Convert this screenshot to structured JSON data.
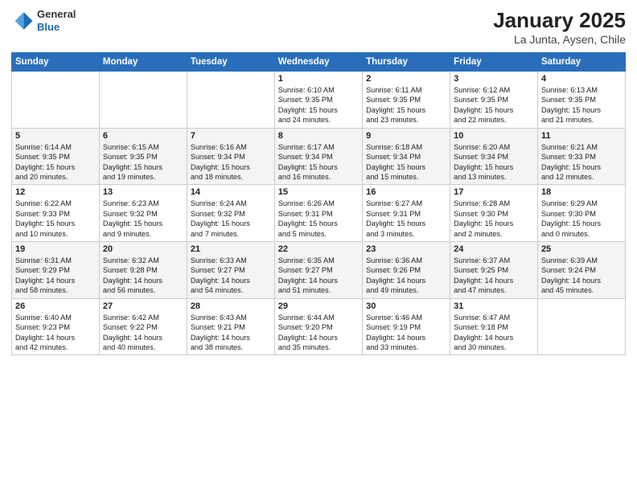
{
  "logo": {
    "general": "General",
    "blue": "Blue"
  },
  "title": "January 2025",
  "subtitle": "La Junta, Aysen, Chile",
  "days_of_week": [
    "Sunday",
    "Monday",
    "Tuesday",
    "Wednesday",
    "Thursday",
    "Friday",
    "Saturday"
  ],
  "weeks": [
    [
      {
        "day": "",
        "info": ""
      },
      {
        "day": "",
        "info": ""
      },
      {
        "day": "",
        "info": ""
      },
      {
        "day": "1",
        "info": "Sunrise: 6:10 AM\nSunset: 9:35 PM\nDaylight: 15 hours\nand 24 minutes."
      },
      {
        "day": "2",
        "info": "Sunrise: 6:11 AM\nSunset: 9:35 PM\nDaylight: 15 hours\nand 23 minutes."
      },
      {
        "day": "3",
        "info": "Sunrise: 6:12 AM\nSunset: 9:35 PM\nDaylight: 15 hours\nand 22 minutes."
      },
      {
        "day": "4",
        "info": "Sunrise: 6:13 AM\nSunset: 9:35 PM\nDaylight: 15 hours\nand 21 minutes."
      }
    ],
    [
      {
        "day": "5",
        "info": "Sunrise: 6:14 AM\nSunset: 9:35 PM\nDaylight: 15 hours\nand 20 minutes."
      },
      {
        "day": "6",
        "info": "Sunrise: 6:15 AM\nSunset: 9:35 PM\nDaylight: 15 hours\nand 19 minutes."
      },
      {
        "day": "7",
        "info": "Sunrise: 6:16 AM\nSunset: 9:34 PM\nDaylight: 15 hours\nand 18 minutes."
      },
      {
        "day": "8",
        "info": "Sunrise: 6:17 AM\nSunset: 9:34 PM\nDaylight: 15 hours\nand 16 minutes."
      },
      {
        "day": "9",
        "info": "Sunrise: 6:18 AM\nSunset: 9:34 PM\nDaylight: 15 hours\nand 15 minutes."
      },
      {
        "day": "10",
        "info": "Sunrise: 6:20 AM\nSunset: 9:34 PM\nDaylight: 15 hours\nand 13 minutes."
      },
      {
        "day": "11",
        "info": "Sunrise: 6:21 AM\nSunset: 9:33 PM\nDaylight: 15 hours\nand 12 minutes."
      }
    ],
    [
      {
        "day": "12",
        "info": "Sunrise: 6:22 AM\nSunset: 9:33 PM\nDaylight: 15 hours\nand 10 minutes."
      },
      {
        "day": "13",
        "info": "Sunrise: 6:23 AM\nSunset: 9:32 PM\nDaylight: 15 hours\nand 9 minutes."
      },
      {
        "day": "14",
        "info": "Sunrise: 6:24 AM\nSunset: 9:32 PM\nDaylight: 15 hours\nand 7 minutes."
      },
      {
        "day": "15",
        "info": "Sunrise: 6:26 AM\nSunset: 9:31 PM\nDaylight: 15 hours\nand 5 minutes."
      },
      {
        "day": "16",
        "info": "Sunrise: 6:27 AM\nSunset: 9:31 PM\nDaylight: 15 hours\nand 3 minutes."
      },
      {
        "day": "17",
        "info": "Sunrise: 6:28 AM\nSunset: 9:30 PM\nDaylight: 15 hours\nand 2 minutes."
      },
      {
        "day": "18",
        "info": "Sunrise: 6:29 AM\nSunset: 9:30 PM\nDaylight: 15 hours\nand 0 minutes."
      }
    ],
    [
      {
        "day": "19",
        "info": "Sunrise: 6:31 AM\nSunset: 9:29 PM\nDaylight: 14 hours\nand 58 minutes."
      },
      {
        "day": "20",
        "info": "Sunrise: 6:32 AM\nSunset: 9:28 PM\nDaylight: 14 hours\nand 56 minutes."
      },
      {
        "day": "21",
        "info": "Sunrise: 6:33 AM\nSunset: 9:27 PM\nDaylight: 14 hours\nand 54 minutes."
      },
      {
        "day": "22",
        "info": "Sunrise: 6:35 AM\nSunset: 9:27 PM\nDaylight: 14 hours\nand 51 minutes."
      },
      {
        "day": "23",
        "info": "Sunrise: 6:36 AM\nSunset: 9:26 PM\nDaylight: 14 hours\nand 49 minutes."
      },
      {
        "day": "24",
        "info": "Sunrise: 6:37 AM\nSunset: 9:25 PM\nDaylight: 14 hours\nand 47 minutes."
      },
      {
        "day": "25",
        "info": "Sunrise: 6:39 AM\nSunset: 9:24 PM\nDaylight: 14 hours\nand 45 minutes."
      }
    ],
    [
      {
        "day": "26",
        "info": "Sunrise: 6:40 AM\nSunset: 9:23 PM\nDaylight: 14 hours\nand 42 minutes."
      },
      {
        "day": "27",
        "info": "Sunrise: 6:42 AM\nSunset: 9:22 PM\nDaylight: 14 hours\nand 40 minutes."
      },
      {
        "day": "28",
        "info": "Sunrise: 6:43 AM\nSunset: 9:21 PM\nDaylight: 14 hours\nand 38 minutes."
      },
      {
        "day": "29",
        "info": "Sunrise: 6:44 AM\nSunset: 9:20 PM\nDaylight: 14 hours\nand 35 minutes."
      },
      {
        "day": "30",
        "info": "Sunrise: 6:46 AM\nSunset: 9:19 PM\nDaylight: 14 hours\nand 33 minutes."
      },
      {
        "day": "31",
        "info": "Sunrise: 6:47 AM\nSunset: 9:18 PM\nDaylight: 14 hours\nand 30 minutes."
      },
      {
        "day": "",
        "info": ""
      }
    ]
  ]
}
